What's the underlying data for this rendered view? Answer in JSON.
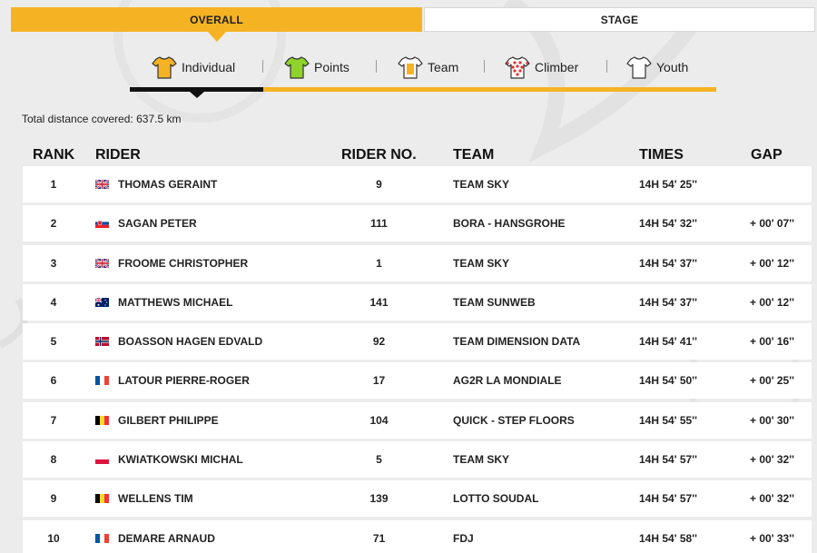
{
  "top_toggle": {
    "overall": "OVERALL",
    "stage": "STAGE"
  },
  "tabs": [
    {
      "label": "Individual",
      "jersey_color": "#f5b324",
      "icon": "yellow-jersey-icon"
    },
    {
      "label": "Points",
      "jersey_color": "#8fd22c",
      "icon": "green-jersey-icon"
    },
    {
      "label": "Team",
      "jersey_color": "#f5b324",
      "icon": "team-jersey-icon"
    },
    {
      "label": "Climber",
      "jersey_color": "#e03030",
      "icon": "polka-dot-jersey-icon"
    },
    {
      "label": "Youth",
      "jersey_color": "#ffffff",
      "icon": "white-jersey-icon"
    }
  ],
  "distance": {
    "label": "Total distance covered:",
    "value": "637.5 km"
  },
  "table": {
    "headers": {
      "rank": "RANK",
      "rider": "RIDER",
      "rider_no": "RIDER NO.",
      "team": "TEAM",
      "times": "TIMES",
      "gap": "GAP"
    },
    "rows": [
      {
        "rank": "1",
        "flag": "gb",
        "rider": "THOMAS GERAINT",
        "rider_no": "9",
        "team": "TEAM SKY",
        "time": "14H 54' 25''",
        "gap": ""
      },
      {
        "rank": "2",
        "flag": "sk",
        "rider": "SAGAN PETER",
        "rider_no": "111",
        "team": "BORA - HANSGROHE",
        "time": "14H 54' 32''",
        "gap": "+ 00' 07''"
      },
      {
        "rank": "3",
        "flag": "gb",
        "rider": "FROOME CHRISTOPHER",
        "rider_no": "1",
        "team": "TEAM SKY",
        "time": "14H 54' 37''",
        "gap": "+ 00' 12''"
      },
      {
        "rank": "4",
        "flag": "au",
        "rider": "MATTHEWS MICHAEL",
        "rider_no": "141",
        "team": "TEAM SUNWEB",
        "time": "14H 54' 37''",
        "gap": "+ 00' 12''"
      },
      {
        "rank": "5",
        "flag": "no",
        "rider": "BOASSON HAGEN EDVALD",
        "rider_no": "92",
        "team": "TEAM DIMENSION DATA",
        "time": "14H 54' 41''",
        "gap": "+ 00' 16''"
      },
      {
        "rank": "6",
        "flag": "fr",
        "rider": "LATOUR PIERRE-ROGER",
        "rider_no": "17",
        "team": "AG2R LA MONDIALE",
        "time": "14H 54' 50''",
        "gap": "+ 00' 25''"
      },
      {
        "rank": "7",
        "flag": "be",
        "rider": "GILBERT PHILIPPE",
        "rider_no": "104",
        "team": "QUICK - STEP FLOORS",
        "time": "14H 54' 55''",
        "gap": "+ 00' 30''"
      },
      {
        "rank": "8",
        "flag": "pl",
        "rider": "KWIATKOWSKI MICHAL",
        "rider_no": "5",
        "team": "TEAM SKY",
        "time": "14H 54' 57''",
        "gap": "+ 00' 32''"
      },
      {
        "rank": "9",
        "flag": "be",
        "rider": "WELLENS TIM",
        "rider_no": "139",
        "team": "LOTTO SOUDAL",
        "time": "14H 54' 57''",
        "gap": "+ 00' 32''"
      },
      {
        "rank": "10",
        "flag": "fr",
        "rider": "DEMARE ARNAUD",
        "rider_no": "71",
        "team": "FDJ",
        "time": "14H 54' 58''",
        "gap": "+ 00' 33''"
      }
    ]
  }
}
